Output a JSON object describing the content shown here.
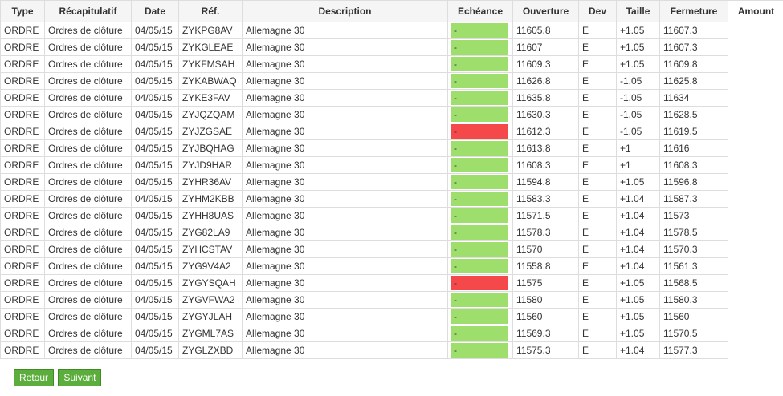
{
  "table": {
    "headers": [
      "Type",
      "Récapitulatif",
      "Date",
      "Réf.",
      "Description",
      "Echéance",
      "Ouverture",
      "Dev",
      "Taille",
      "Fermeture",
      "Amount"
    ],
    "rows": [
      {
        "type": "ORDRE",
        "summary": "Ordres de clôture",
        "date": "04/05/15",
        "ref": "ZYKPG8AV",
        "description": "Allemagne 30",
        "expiry": "-",
        "expiry_status": "green",
        "open": "11605.8",
        "dev": "E",
        "size": "+1.05",
        "close": "11607.3"
      },
      {
        "type": "ORDRE",
        "summary": "Ordres de clôture",
        "date": "04/05/15",
        "ref": "ZYKGLEAE",
        "description": "Allemagne 30",
        "expiry": "-",
        "expiry_status": "green",
        "open": "11607",
        "dev": "E",
        "size": "+1.05",
        "close": "11607.3"
      },
      {
        "type": "ORDRE",
        "summary": "Ordres de clôture",
        "date": "04/05/15",
        "ref": "ZYKFMSAH",
        "description": "Allemagne 30",
        "expiry": "-",
        "expiry_status": "green",
        "open": "11609.3",
        "dev": "E",
        "size": "+1.05",
        "close": "11609.8"
      },
      {
        "type": "ORDRE",
        "summary": "Ordres de clôture",
        "date": "04/05/15",
        "ref": "ZYKABWAQ",
        "description": "Allemagne 30",
        "expiry": "-",
        "expiry_status": "green",
        "open": "11626.8",
        "dev": "E",
        "size": "-1.05",
        "close": "11625.8"
      },
      {
        "type": "ORDRE",
        "summary": "Ordres de clôture",
        "date": "04/05/15",
        "ref": "ZYKE3FAV",
        "description": "Allemagne 30",
        "expiry": "-",
        "expiry_status": "green",
        "open": "11635.8",
        "dev": "E",
        "size": "-1.05",
        "close": "11634"
      },
      {
        "type": "ORDRE",
        "summary": "Ordres de clôture",
        "date": "04/05/15",
        "ref": "ZYJQZQAM",
        "description": "Allemagne 30",
        "expiry": "-",
        "expiry_status": "green",
        "open": "11630.3",
        "dev": "E",
        "size": "-1.05",
        "close": "11628.5"
      },
      {
        "type": "ORDRE",
        "summary": "Ordres de clôture",
        "date": "04/05/15",
        "ref": "ZYJZGSAE",
        "description": "Allemagne 30",
        "expiry": "-",
        "expiry_status": "red",
        "open": "11612.3",
        "dev": "E",
        "size": "-1.05",
        "close": "11619.5"
      },
      {
        "type": "ORDRE",
        "summary": "Ordres de clôture",
        "date": "04/05/15",
        "ref": "ZYJBQHAG",
        "description": "Allemagne 30",
        "expiry": "-",
        "expiry_status": "green",
        "open": "11613.8",
        "dev": "E",
        "size": "+1",
        "close": "11616"
      },
      {
        "type": "ORDRE",
        "summary": "Ordres de clôture",
        "date": "04/05/15",
        "ref": "ZYJD9HAR",
        "description": "Allemagne 30",
        "expiry": "-",
        "expiry_status": "green",
        "open": "11608.3",
        "dev": "E",
        "size": "+1",
        "close": "11608.3"
      },
      {
        "type": "ORDRE",
        "summary": "Ordres de clôture",
        "date": "04/05/15",
        "ref": "ZYHR36AV",
        "description": "Allemagne 30",
        "expiry": "-",
        "expiry_status": "green",
        "open": "11594.8",
        "dev": "E",
        "size": "+1.05",
        "close": "11596.8"
      },
      {
        "type": "ORDRE",
        "summary": "Ordres de clôture",
        "date": "04/05/15",
        "ref": "ZYHM2KBB",
        "description": "Allemagne 30",
        "expiry": "-",
        "expiry_status": "green",
        "open": "11583.3",
        "dev": "E",
        "size": "+1.04",
        "close": "11587.3"
      },
      {
        "type": "ORDRE",
        "summary": "Ordres de clôture",
        "date": "04/05/15",
        "ref": "ZYHH8UAS",
        "description": "Allemagne 30",
        "expiry": "-",
        "expiry_status": "green",
        "open": "11571.5",
        "dev": "E",
        "size": "+1.04",
        "close": "11573"
      },
      {
        "type": "ORDRE",
        "summary": "Ordres de clôture",
        "date": "04/05/15",
        "ref": "ZYG82LA9",
        "description": "Allemagne 30",
        "expiry": "-",
        "expiry_status": "green",
        "open": "11578.3",
        "dev": "E",
        "size": "+1.04",
        "close": "11578.5"
      },
      {
        "type": "ORDRE",
        "summary": "Ordres de clôture",
        "date": "04/05/15",
        "ref": "ZYHCSTAV",
        "description": "Allemagne 30",
        "expiry": "-",
        "expiry_status": "green",
        "open": "11570",
        "dev": "E",
        "size": "+1.04",
        "close": "11570.3"
      },
      {
        "type": "ORDRE",
        "summary": "Ordres de clôture",
        "date": "04/05/15",
        "ref": "ZYG9V4A2",
        "description": "Allemagne 30",
        "expiry": "-",
        "expiry_status": "green",
        "open": "11558.8",
        "dev": "E",
        "size": "+1.04",
        "close": "11561.3"
      },
      {
        "type": "ORDRE",
        "summary": "Ordres de clôture",
        "date": "04/05/15",
        "ref": "ZYGYSQAH",
        "description": "Allemagne 30",
        "expiry": "-",
        "expiry_status": "red",
        "open": "11575",
        "dev": "E",
        "size": "+1.05",
        "close": "11568.5"
      },
      {
        "type": "ORDRE",
        "summary": "Ordres de clôture",
        "date": "04/05/15",
        "ref": "ZYGVFWA2",
        "description": "Allemagne 30",
        "expiry": "-",
        "expiry_status": "green",
        "open": "11580",
        "dev": "E",
        "size": "+1.05",
        "close": "11580.3"
      },
      {
        "type": "ORDRE",
        "summary": "Ordres de clôture",
        "date": "04/05/15",
        "ref": "ZYGYJLAH",
        "description": "Allemagne 30",
        "expiry": "-",
        "expiry_status": "green",
        "open": "11560",
        "dev": "E",
        "size": "+1.05",
        "close": "11560"
      },
      {
        "type": "ORDRE",
        "summary": "Ordres de clôture",
        "date": "04/05/15",
        "ref": "ZYGML7AS",
        "description": "Allemagne 30",
        "expiry": "-",
        "expiry_status": "green",
        "open": "11569.3",
        "dev": "E",
        "size": "+1.05",
        "close": "11570.5"
      },
      {
        "type": "ORDRE",
        "summary": "Ordres de clôture",
        "date": "04/05/15",
        "ref": "ZYGLZXBD",
        "description": "Allemagne 30",
        "expiry": "-",
        "expiry_status": "green",
        "open": "11575.3",
        "dev": "E",
        "size": "+1.04",
        "close": "11577.3"
      }
    ]
  },
  "nav": {
    "back_label": "Retour",
    "next_label": "Suivant"
  },
  "colors": {
    "green": "#9ede6c",
    "red": "#f5484a",
    "button": "#5cae3c"
  }
}
